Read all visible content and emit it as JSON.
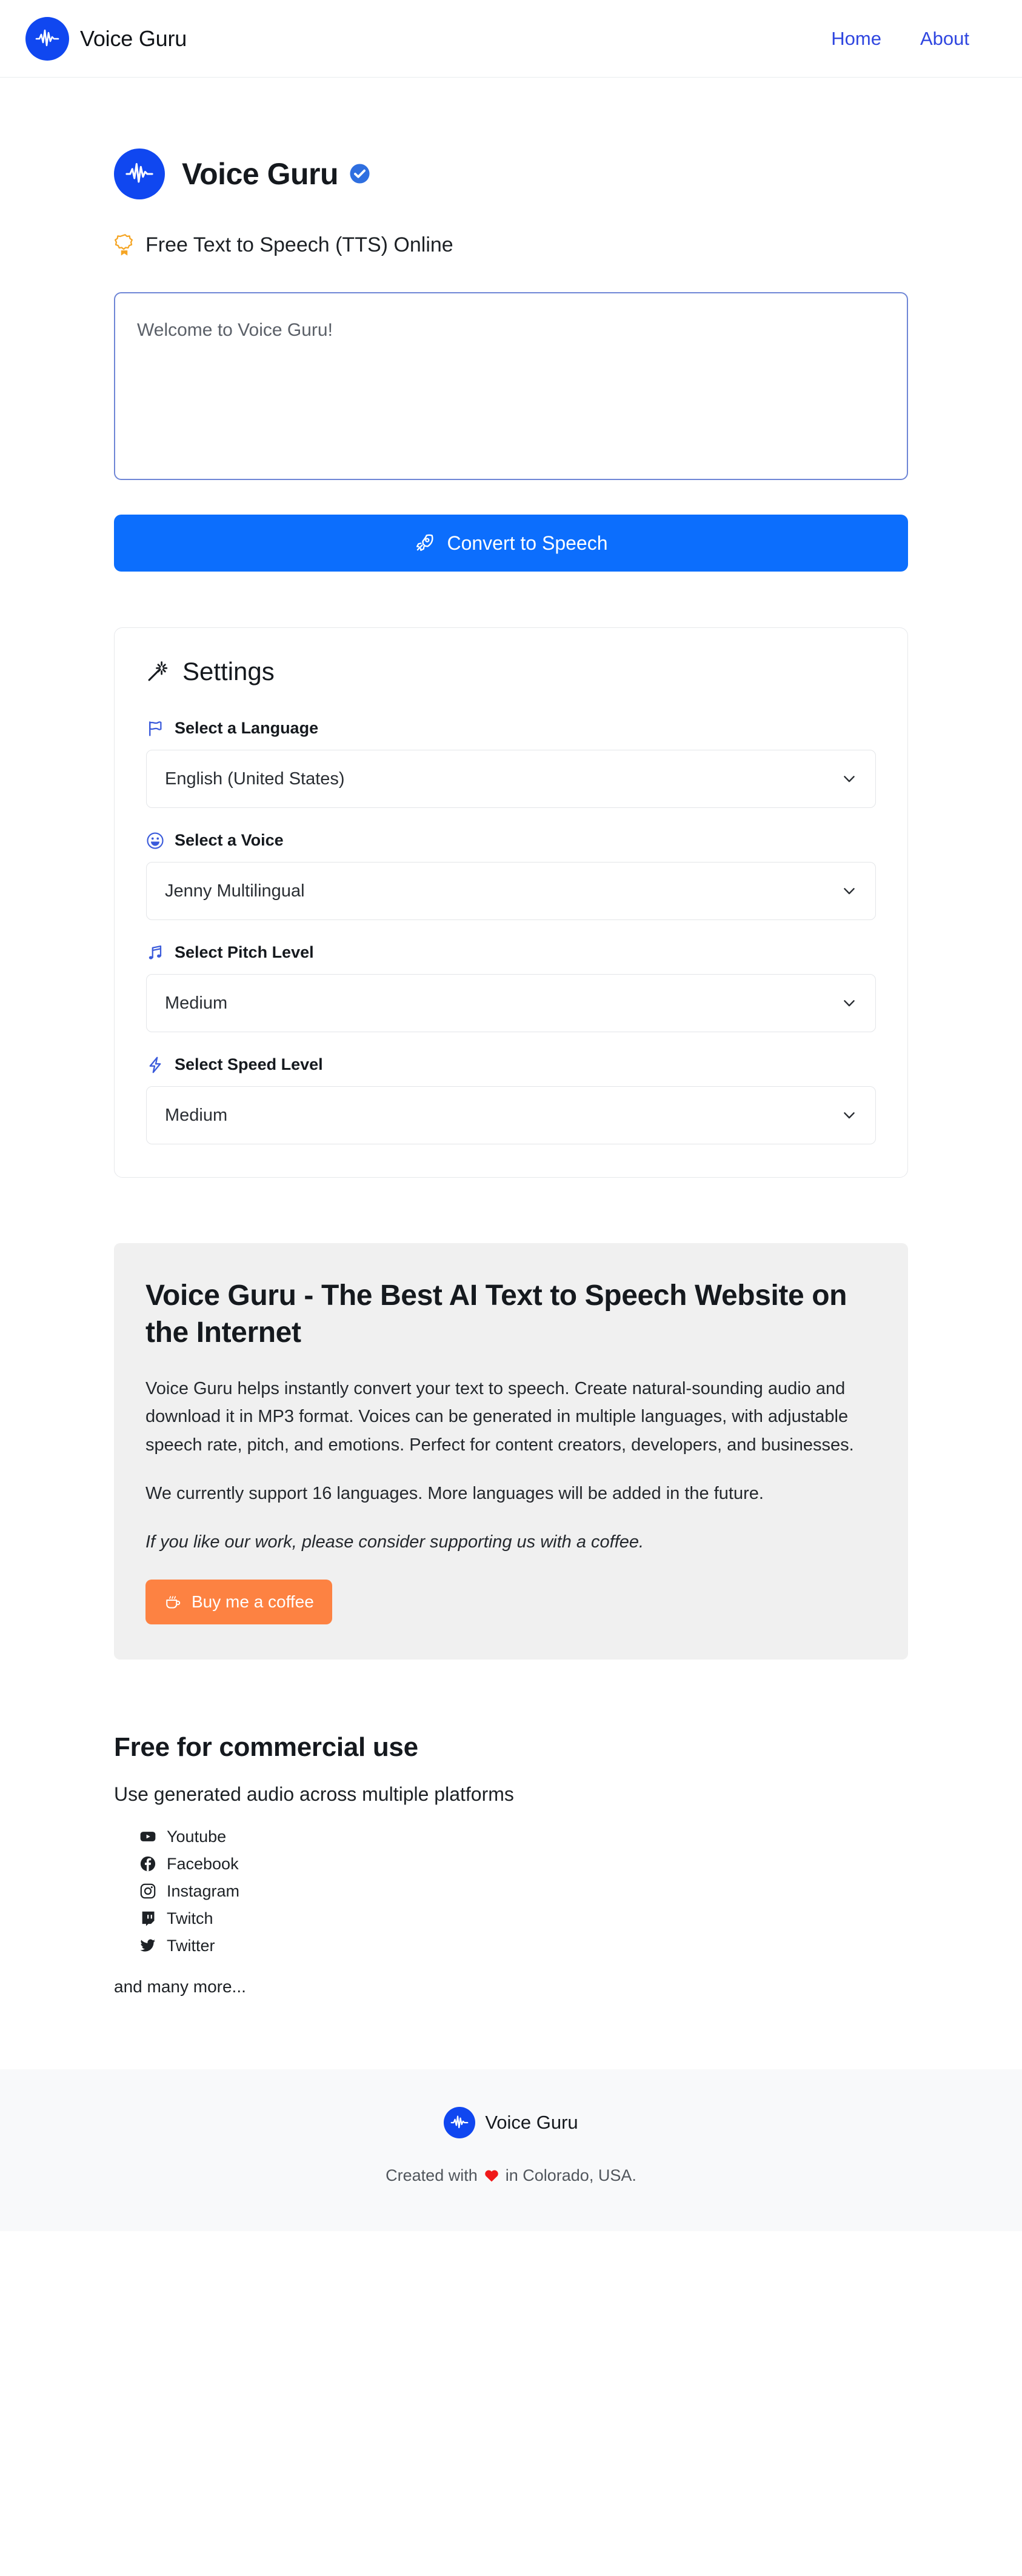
{
  "brand": {
    "name": "Voice Guru",
    "logo_icon": "waveform-icon",
    "logo_color": "#1047f0"
  },
  "navbar": {
    "links": [
      {
        "label": "Home",
        "name": "nav-link-home"
      },
      {
        "label": "About",
        "name": "nav-link-about"
      }
    ],
    "link_color": "#2f46e0"
  },
  "hero": {
    "title": "Voice Guru",
    "verified_icon": "verified-badge-icon",
    "tagline": "Free Text to Speech (TTS) Online",
    "tagline_icon": "award-icon"
  },
  "editor": {
    "text_value": "Welcome to Voice Guru!",
    "placeholder": "Welcome to Voice Guru!",
    "border_color": "#6f86d6"
  },
  "convert": {
    "label": "Convert to Speech",
    "icon": "rocket-icon",
    "color": "#0c6efd"
  },
  "settings": {
    "title": "Settings",
    "title_icon": "magic-wand-icon",
    "fields": [
      {
        "label": "Select a Language",
        "icon": "flag-icon",
        "value": "English (United States)",
        "name": "language-select"
      },
      {
        "label": "Select a Voice",
        "icon": "smiley-icon",
        "value": "Jenny Multilingual",
        "name": "voice-select"
      },
      {
        "label": "Select Pitch Level",
        "icon": "music-note-icon",
        "value": "Medium",
        "name": "pitch-select"
      },
      {
        "label": "Select Speed Level",
        "icon": "lightning-icon",
        "value": "Medium",
        "name": "speed-select"
      }
    ]
  },
  "info": {
    "title": "Voice Guru - The Best AI Text to Speech Website on the Internet",
    "paragraph1": "Voice Guru helps instantly convert your text to speech. Create natural-sounding audio and download it in MP3 format. Voices can be generated in multiple languages, with adjustable speech rate, pitch, and emotions. Perfect for content creators, developers, and businesses.",
    "paragraph2": "We currently support 16 languages. More languages will be added in the future.",
    "support_line": "If you like our work, please consider supporting us with a coffee.",
    "coffee_label": "Buy me a coffee",
    "coffee_icon": "coffee-cup-icon",
    "coffee_color": "#fd8242",
    "background": "#f0f0f0"
  },
  "commercial": {
    "title": "Free for commercial use",
    "subtitle": "Use generated audio across multiple platforms",
    "platforms": [
      {
        "label": "Youtube",
        "icon": "youtube-icon"
      },
      {
        "label": "Facebook",
        "icon": "facebook-icon"
      },
      {
        "label": "Instagram",
        "icon": "instagram-icon"
      },
      {
        "label": "Twitch",
        "icon": "twitch-icon"
      },
      {
        "label": "Twitter",
        "icon": "twitter-icon"
      }
    ],
    "more_text": "and many more..."
  },
  "footer": {
    "brand": "Voice Guru",
    "credit_prefix": "Created with",
    "credit_icon": "heart-icon",
    "credit_suffix": "in Colorado, USA.",
    "background": "#f8f9fa"
  }
}
